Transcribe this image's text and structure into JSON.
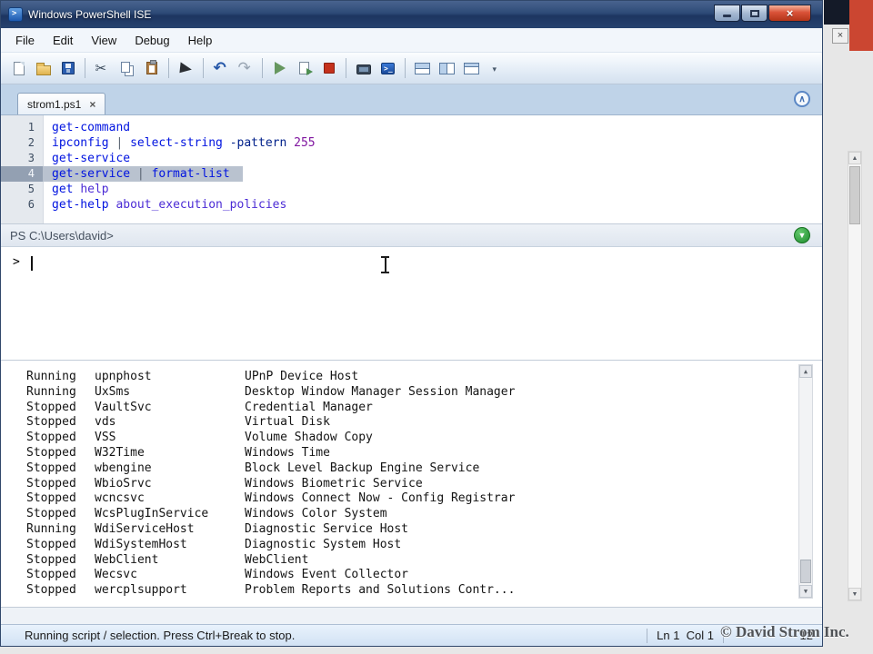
{
  "window": {
    "title": "Windows PowerShell ISE",
    "menus": [
      "File",
      "Edit",
      "View",
      "Debug",
      "Help"
    ],
    "tab": {
      "label": "strom1.ps1",
      "close_glyph": "×"
    },
    "controls": {
      "close_glyph": "×"
    }
  },
  "toolbar": {
    "items": [
      {
        "name": "new-script-button",
        "icon": "new-file-icon",
        "type": "new"
      },
      {
        "name": "open-script-button",
        "icon": "open-folder-icon",
        "type": "open"
      },
      {
        "name": "save-button",
        "icon": "save-icon",
        "type": "save"
      },
      {
        "sep": true
      },
      {
        "name": "cut-button",
        "icon": "scissors-icon",
        "type": "cut"
      },
      {
        "name": "copy-button",
        "icon": "copy-icon",
        "type": "copy"
      },
      {
        "name": "paste-button",
        "icon": "clipboard-icon",
        "type": "paste"
      },
      {
        "sep": true
      },
      {
        "name": "clear-output-button",
        "icon": "clear-pane-icon",
        "type": "clear"
      },
      {
        "sep": true
      },
      {
        "name": "undo-button",
        "icon": "undo-arrow-icon",
        "type": "undo"
      },
      {
        "name": "redo-button",
        "icon": "redo-arrow-icon",
        "type": "redo"
      },
      {
        "sep": true
      },
      {
        "name": "run-script-button",
        "icon": "play-icon",
        "type": "run"
      },
      {
        "name": "run-selection-button",
        "icon": "run-selection-icon",
        "type": "runsel"
      },
      {
        "name": "stop-execution-button",
        "icon": "stop-square-icon",
        "type": "stop"
      },
      {
        "sep": true
      },
      {
        "name": "new-remote-powershell-tab-button",
        "icon": "remote-computer-icon",
        "type": "remote"
      },
      {
        "name": "start-powershell-console-button",
        "icon": "powershell-console-icon",
        "type": "psexe"
      },
      {
        "sep": true
      },
      {
        "name": "layout-script-pane-top-button",
        "icon": "layout-split-horizontal-icon",
        "type": "laytop"
      },
      {
        "name": "layout-script-pane-right-button",
        "icon": "layout-split-vertical-icon",
        "type": "layright"
      },
      {
        "name": "layout-script-pane-max-button",
        "icon": "layout-single-pane-icon",
        "type": "laymax"
      },
      {
        "name": "toolbar-overflow-button",
        "icon": "chevron-down-icon",
        "type": "overflow"
      }
    ]
  },
  "editor": {
    "lines": [
      {
        "n": "1",
        "segs": [
          {
            "t": "get-command",
            "c": "cmd"
          }
        ]
      },
      {
        "n": "2",
        "segs": [
          {
            "t": "ipconfig ",
            "c": "cmd"
          },
          {
            "t": "| ",
            "c": "op"
          },
          {
            "t": "select-string ",
            "c": "cmd"
          },
          {
            "t": "-pattern ",
            "c": "param"
          },
          {
            "t": "255",
            "c": "num"
          }
        ]
      },
      {
        "n": "3",
        "segs": [
          {
            "t": "get-service",
            "c": "cmd"
          }
        ]
      },
      {
        "n": "4",
        "selected": true,
        "segs": [
          {
            "t": "get-service ",
            "c": "cmd"
          },
          {
            "t": "| ",
            "c": "op"
          },
          {
            "t": "format-list",
            "c": "cmd"
          }
        ]
      },
      {
        "n": "5",
        "segs": [
          {
            "t": "get ",
            "c": "cmd"
          },
          {
            "t": "help",
            "c": "arg"
          }
        ]
      },
      {
        "n": "6",
        "segs": [
          {
            "t": "get-help ",
            "c": "cmd"
          },
          {
            "t": "about_execution_policies",
            "c": "arg"
          }
        ]
      }
    ]
  },
  "console": {
    "path": "PS C:\\Users\\david>",
    "prompt": ">"
  },
  "output": {
    "rows": [
      {
        "status": "Running",
        "name": "upnphost",
        "desc": "UPnP Device Host"
      },
      {
        "status": "Running",
        "name": "UxSms",
        "desc": "Desktop Window Manager Session Manager"
      },
      {
        "status": "Stopped",
        "name": "VaultSvc",
        "desc": "Credential Manager"
      },
      {
        "status": "Stopped",
        "name": "vds",
        "desc": "Virtual Disk"
      },
      {
        "status": "Stopped",
        "name": "VSS",
        "desc": "Volume Shadow Copy"
      },
      {
        "status": "Stopped",
        "name": "W32Time",
        "desc": "Windows Time"
      },
      {
        "status": "Stopped",
        "name": "wbengine",
        "desc": "Block Level Backup Engine Service"
      },
      {
        "status": "Stopped",
        "name": "WbioSrvc",
        "desc": "Windows Biometric Service"
      },
      {
        "status": "Stopped",
        "name": "wcncsvc",
        "desc": "Windows Connect Now - Config Registrar"
      },
      {
        "status": "Stopped",
        "name": "WcsPlugInService",
        "desc": "Windows Color System"
      },
      {
        "status": "Running",
        "name": "WdiServiceHost",
        "desc": "Diagnostic Service Host"
      },
      {
        "status": "Stopped",
        "name": "WdiSystemHost",
        "desc": "Diagnostic System Host"
      },
      {
        "status": "Stopped",
        "name": "WebClient",
        "desc": "WebClient"
      },
      {
        "status": "Stopped",
        "name": "Wecsvc",
        "desc": "Windows Event Collector"
      },
      {
        "status": "Stopped",
        "name": "wercplsupport",
        "desc": "Problem Reports and Solutions Contr..."
      }
    ]
  },
  "status_bar": {
    "left": "Running script / selection. Press Ctrl+Break to stop.",
    "position": "Ln 1  Col 1",
    "extra": "12"
  },
  "glyphs": {
    "collapse": "∧",
    "expand": "▼",
    "scroll_up": "▲",
    "scroll_down": "▼",
    "close": "×"
  },
  "watermark": "© David Strom Inc.",
  "colors": {
    "title_bar": "#2d4a77",
    "close_button_red": "#b33418",
    "stop_red": "#c4311c",
    "side_accent_orange": "#cb4631",
    "token_command": "#0013e0",
    "token_parameter": "#00208a",
    "token_argument": "#4b2bd5",
    "token_number": "#8016a0",
    "selection": "#b9c2cf"
  }
}
